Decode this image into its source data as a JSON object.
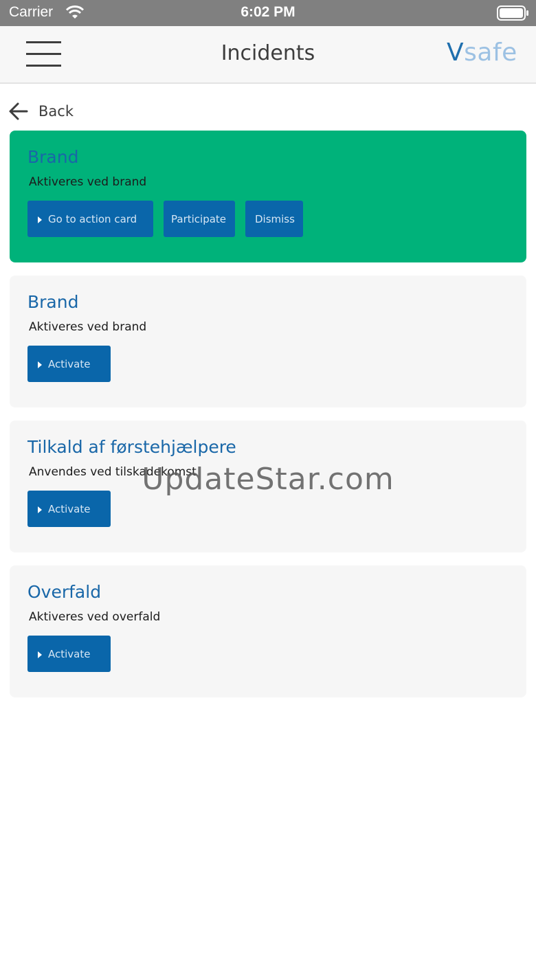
{
  "status_bar": {
    "carrier": "Carrier",
    "time": "6:02 PM",
    "icons": [
      "wifi-icon",
      "battery-icon"
    ]
  },
  "header": {
    "title": "Incidents",
    "logo_first": "V",
    "logo_rest": "safe",
    "menu_icon": "hamburger-menu-icon"
  },
  "back": {
    "label": "Back",
    "icon": "arrow-left-icon"
  },
  "incidents": [
    {
      "title": "Brand",
      "description": "Aktiveres ved brand",
      "state": "active",
      "buttons": [
        "Go to action card",
        "Participate",
        "Dismiss"
      ]
    },
    {
      "title": "Brand",
      "description": "Aktiveres ved brand",
      "buttons": [
        "Activate"
      ]
    },
    {
      "title": "Tilkald af førstehjælpere",
      "description": "Anvendes ved tilskadekomst",
      "buttons": [
        "Activate"
      ]
    },
    {
      "title": "Overfald",
      "description": "Aktiveres ved overfald",
      "buttons": [
        "Activate"
      ]
    }
  ],
  "watermark": "UpdateStar.com",
  "colors": {
    "active_card": "#00b27a",
    "card": "#f6f6f6",
    "button": "#0a66aa",
    "title_text": "#1967a8",
    "logo_v": "#1f6fae",
    "logo_rest": "#9cc1e3"
  }
}
